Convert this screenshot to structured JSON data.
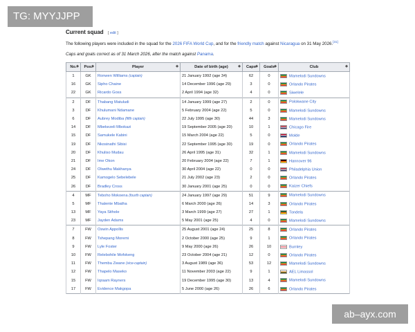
{
  "tag": "TG: MYYJJPP",
  "watermark": "ab–ayx.com",
  "heading": "Current squad",
  "edit_label": "edit",
  "intro": {
    "p1": "The following players were included in the squad for the ",
    "l1": "2026 FIFA World Cup",
    "p2": ", and for the ",
    "l2": "friendly match",
    "p3": " against ",
    "l3": "Nicaragua",
    "p4": " on 31 May 2026.",
    "ref": "[31]"
  },
  "caps_note": {
    "p1": "Caps and goals correct as of 31 March 2026, after the match against ",
    "l1": "Panama",
    "p2": "."
  },
  "columns": [
    "No.",
    "Pos.",
    "Player",
    "Date of birth (age)",
    "Caps",
    "Goals",
    "Club"
  ],
  "flag_colors": {
    "ZA": [
      "#007a4d",
      "#ffb612",
      "#de3831"
    ],
    "US": [
      "#b22234",
      "#ffffff",
      "#3c3b6e"
    ],
    "NO": [
      "#ba0c2f",
      "#ffffff",
      "#00205b"
    ],
    "DE": [
      "#000000",
      "#dd0000",
      "#ffce00"
    ],
    "PT": [
      "#046a38",
      "#da291c",
      "#ffcc00"
    ],
    "EN": [
      "#ffffff",
      "#ce1124",
      "#ffffff"
    ],
    "CY": [
      "#ffffff",
      "#d57800",
      "#4e5b31"
    ]
  },
  "rows": [
    {
      "no": "1",
      "pos": "GK",
      "player": "Ronwen Williams",
      "role": "(captain)",
      "dob": "21 January 1992 (age 34)",
      "caps": "62",
      "goals": "0",
      "flag": "ZA",
      "club": "Mamelodi Sundowns"
    },
    {
      "no": "16",
      "pos": "GK",
      "player": "Sipho Chaine",
      "role": "",
      "dob": "14 December 1996 (age 29)",
      "caps": "3",
      "goals": "0",
      "flag": "ZA",
      "club": "Orlando Pirates"
    },
    {
      "no": "22",
      "pos": "GK",
      "player": "Ricardo Goss",
      "role": "",
      "dob": "2 April 1994 (age 32)",
      "caps": "4",
      "goals": "0",
      "flag": "ZA",
      "club": "Siwelele"
    },
    {
      "no": "2",
      "pos": "DF",
      "player": "Thabang Matuludi",
      "role": "",
      "dob": "14 January 1999 (age 27)",
      "caps": "2",
      "goals": "0",
      "flag": "ZA",
      "club": "Polokwane City"
    },
    {
      "no": "3",
      "pos": "DF",
      "player": "Khulumani Ndamane",
      "role": "",
      "dob": "5 February 2004 (age 22)",
      "caps": "5",
      "goals": "0",
      "flag": "ZA",
      "club": "Mamelodi Sundowns"
    },
    {
      "no": "6",
      "pos": "DF",
      "player": "Aubrey Modiba",
      "role": "(fifth captain)",
      "dob": "22 July 1995 (age 30)",
      "caps": "44",
      "goals": "3",
      "flag": "ZA",
      "club": "Mamelodi Sundowns"
    },
    {
      "no": "14",
      "pos": "DF",
      "player": "Mbekezeli Mbokazi",
      "role": "",
      "dob": "19 September 2005 (age 20)",
      "caps": "10",
      "goals": "1",
      "flag": "US",
      "club": "Chicago Fire"
    },
    {
      "no": "15",
      "pos": "DF",
      "player": "Samukele Kabini",
      "role": "",
      "dob": "15 March 2004 (age 22)",
      "caps": "5",
      "goals": "0",
      "flag": "NO",
      "club": "Molde"
    },
    {
      "no": "19",
      "pos": "DF",
      "player": "Nkosinathi Sibisi",
      "role": "",
      "dob": "22 September 1995 (age 30)",
      "caps": "19",
      "goals": "0",
      "flag": "ZA",
      "club": "Orlando Pirates"
    },
    {
      "no": "20",
      "pos": "DF",
      "player": "Khuliso Mudau",
      "role": "",
      "dob": "26 April 1995 (age 31)",
      "caps": "32",
      "goals": "1",
      "flag": "ZA",
      "club": "Mamelodi Sundowns"
    },
    {
      "no": "21",
      "pos": "DF",
      "player": "Ime Okon",
      "role": "",
      "dob": "20 February 2004 (age 22)",
      "caps": "7",
      "goals": "1",
      "flag": "DE",
      "club": "Hannover 96"
    },
    {
      "no": "24",
      "pos": "DF",
      "player": "Olwethu Makhanya",
      "role": "",
      "dob": "30 April 2004 (age 22)",
      "caps": "0",
      "goals": "0",
      "flag": "US",
      "club": "Philadelphia Union"
    },
    {
      "no": "25",
      "pos": "DF",
      "player": "Kamogelo Sebelebele",
      "role": "",
      "dob": "21 July 2002 (age 23)",
      "caps": "2",
      "goals": "0",
      "flag": "ZA",
      "club": "Orlando Pirates"
    },
    {
      "no": "26",
      "pos": "DF",
      "player": "Bradley Cross",
      "role": "",
      "dob": "30 January 2001 (age 25)",
      "caps": "0",
      "goals": "0",
      "flag": "ZA",
      "club": "Kaizer Chiefs"
    },
    {
      "no": "4",
      "pos": "MF",
      "player": "Teboho Mokoena",
      "role": "(fourth captain)",
      "dob": "24 January 1997 (age 29)",
      "caps": "51",
      "goals": "9",
      "flag": "ZA",
      "club": "Mamelodi Sundowns"
    },
    {
      "no": "5",
      "pos": "MF",
      "player": "Thalente Mbatha",
      "role": "",
      "dob": "6 March 2000 (age 26)",
      "caps": "14",
      "goals": "3",
      "flag": "ZA",
      "club": "Orlando Pirates"
    },
    {
      "no": "13",
      "pos": "MF",
      "player": "Yaya Sithole",
      "role": "",
      "dob": "3 March 1999 (age 27)",
      "caps": "27",
      "goals": "1",
      "flag": "PT",
      "club": "Tondela"
    },
    {
      "no": "23",
      "pos": "MF",
      "player": "Jayden Adams",
      "role": "",
      "dob": "5 May 2001 (age 25)",
      "caps": "4",
      "goals": "0",
      "flag": "ZA",
      "club": "Mamelodi Sundowns"
    },
    {
      "no": "7",
      "pos": "FW",
      "player": "Oswin Appollis",
      "role": "",
      "dob": "25 August 2001 (age 24)",
      "caps": "25",
      "goals": "8",
      "flag": "ZA",
      "club": "Orlando Pirates"
    },
    {
      "no": "8",
      "pos": "FW",
      "player": "Tshepang Moremi",
      "role": "",
      "dob": "2 October 2000 (age 25)",
      "caps": "9",
      "goals": "1",
      "flag": "ZA",
      "club": "Orlando Pirates"
    },
    {
      "no": "9",
      "pos": "FW",
      "player": "Lyle Foster",
      "role": "",
      "dob": "9 May 2000 (age 26)",
      "caps": "26",
      "goals": "10",
      "flag": "EN",
      "club": "Burnley"
    },
    {
      "no": "10",
      "pos": "FW",
      "player": "Relebohile Mofokeng",
      "role": "",
      "dob": "23 October 2004 (age 21)",
      "caps": "12",
      "goals": "0",
      "flag": "ZA",
      "club": "Orlando Pirates"
    },
    {
      "no": "11",
      "pos": "FW",
      "player": "Themba Zwane",
      "role": "(vice-captain)",
      "dob": "3 August 1989 (age 36)",
      "caps": "53",
      "goals": "12",
      "flag": "ZA",
      "club": "Mamelodi Sundowns"
    },
    {
      "no": "12",
      "pos": "FW",
      "player": "Thapelo Maseko",
      "role": "",
      "dob": "11 November 2003 (age 22)",
      "caps": "9",
      "goals": "1",
      "flag": "CY",
      "club": "AEL Limassol"
    },
    {
      "no": "15",
      "pos": "FW",
      "player": "Iqraam Rayners",
      "role": "",
      "dob": "19 December 1995 (age 30)",
      "caps": "13",
      "goals": "4",
      "flag": "ZA",
      "club": "Mamelodi Sundowns"
    },
    {
      "no": "17",
      "pos": "FW",
      "player": "Evidence Makgopa",
      "role": "",
      "dob": "5 June 2000 (age 26)",
      "caps": "26",
      "goals": "6",
      "flag": "ZA",
      "club": "Orlando Pirates"
    }
  ]
}
